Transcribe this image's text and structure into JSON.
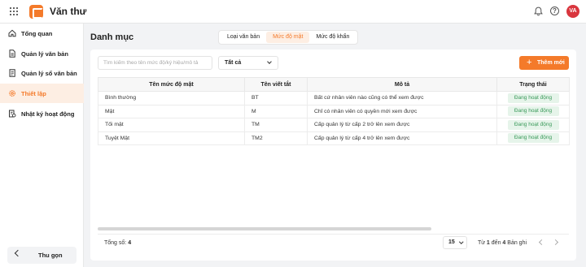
{
  "header": {
    "app_title": "Văn thư",
    "avatar_initials": "VA"
  },
  "sidebar": {
    "items": [
      {
        "label": "Tổng quan",
        "icon": "home-icon",
        "active": false
      },
      {
        "label": "Quản lý văn bản",
        "icon": "document-icon",
        "active": false
      },
      {
        "label": "Quản lý sổ văn bản",
        "icon": "book-icon",
        "active": false
      },
      {
        "label": "Thiết lập",
        "icon": "gear-icon",
        "active": true
      },
      {
        "label": "Nhật ký hoạt động",
        "icon": "log-icon",
        "active": false
      }
    ],
    "collapse_label": "Thu gọn"
  },
  "main": {
    "title": "Danh mục",
    "tabs": [
      {
        "label": "Loại văn bản",
        "active": false
      },
      {
        "label": "Mức độ mật",
        "active": true
      },
      {
        "label": "Mức độ khẩn",
        "active": false
      }
    ],
    "search_placeholder": "Tìm kiếm theo tên mức độ/ký hiệu/mô tả",
    "filter_value": "Tất cả",
    "add_label": "Thêm mới",
    "table": {
      "columns": [
        "Tên mức độ mật",
        "Tên viết tắt",
        "Mô tả",
        "Trạng thái"
      ],
      "rows": [
        [
          "Bình thường",
          "BT",
          "Bất cứ nhân viên nào cũng có thể xem được",
          "Đang hoạt động"
        ],
        [
          "Mật",
          "M",
          "Chỉ có nhân viên có quyền mới xem được",
          "Đang hoạt động"
        ],
        [
          "Tối mật",
          "TM",
          "Cấp quản lý từ cấp 2 trở lên xem được",
          "Đang hoạt động"
        ],
        [
          "Tuyệt Mật",
          "TM2",
          "Cấp quản lý từ cấp 4 trở lên xem được",
          "Đang hoạt động"
        ]
      ]
    },
    "footer": {
      "total_label": "Tổng số:",
      "total_value": "4",
      "page_size": "15",
      "range_from_label": "Từ",
      "range_from": "1",
      "range_to_label": "đến",
      "range_to": "4",
      "range_suffix": "Bản ghi"
    }
  },
  "colors": {
    "accent": "#f47a2a",
    "status_bg": "#e6f4ea",
    "status_text": "#3a9a5a",
    "avatar": "#d9363e"
  }
}
